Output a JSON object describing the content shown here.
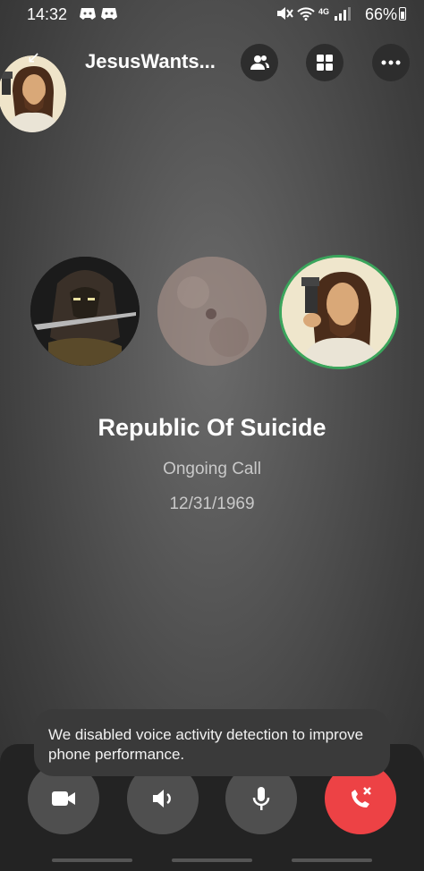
{
  "status_bar": {
    "time": "14:32",
    "battery": "66%",
    "icons": [
      "discord-icon",
      "discord-icon",
      "mute-icon",
      "wifi-icon",
      "4g-signal-icon",
      "battery-icon"
    ]
  },
  "header": {
    "title": "JesusWants...",
    "buttons": [
      "participants-icon",
      "grid-icon",
      "more-icon"
    ]
  },
  "call": {
    "name": "Republic Of Suicide",
    "status": "Ongoing Call",
    "date": "12/31/1969"
  },
  "toast": {
    "message": "We disabled voice activity detection to improve phone performance."
  },
  "controls": [
    "camera-icon",
    "speaker-icon",
    "microphone-icon",
    "end-call-icon"
  ],
  "colors": {
    "speaking_ring": "#3ba55c",
    "end_call": "#ed4245",
    "button_bg": "#4f4f4f"
  }
}
